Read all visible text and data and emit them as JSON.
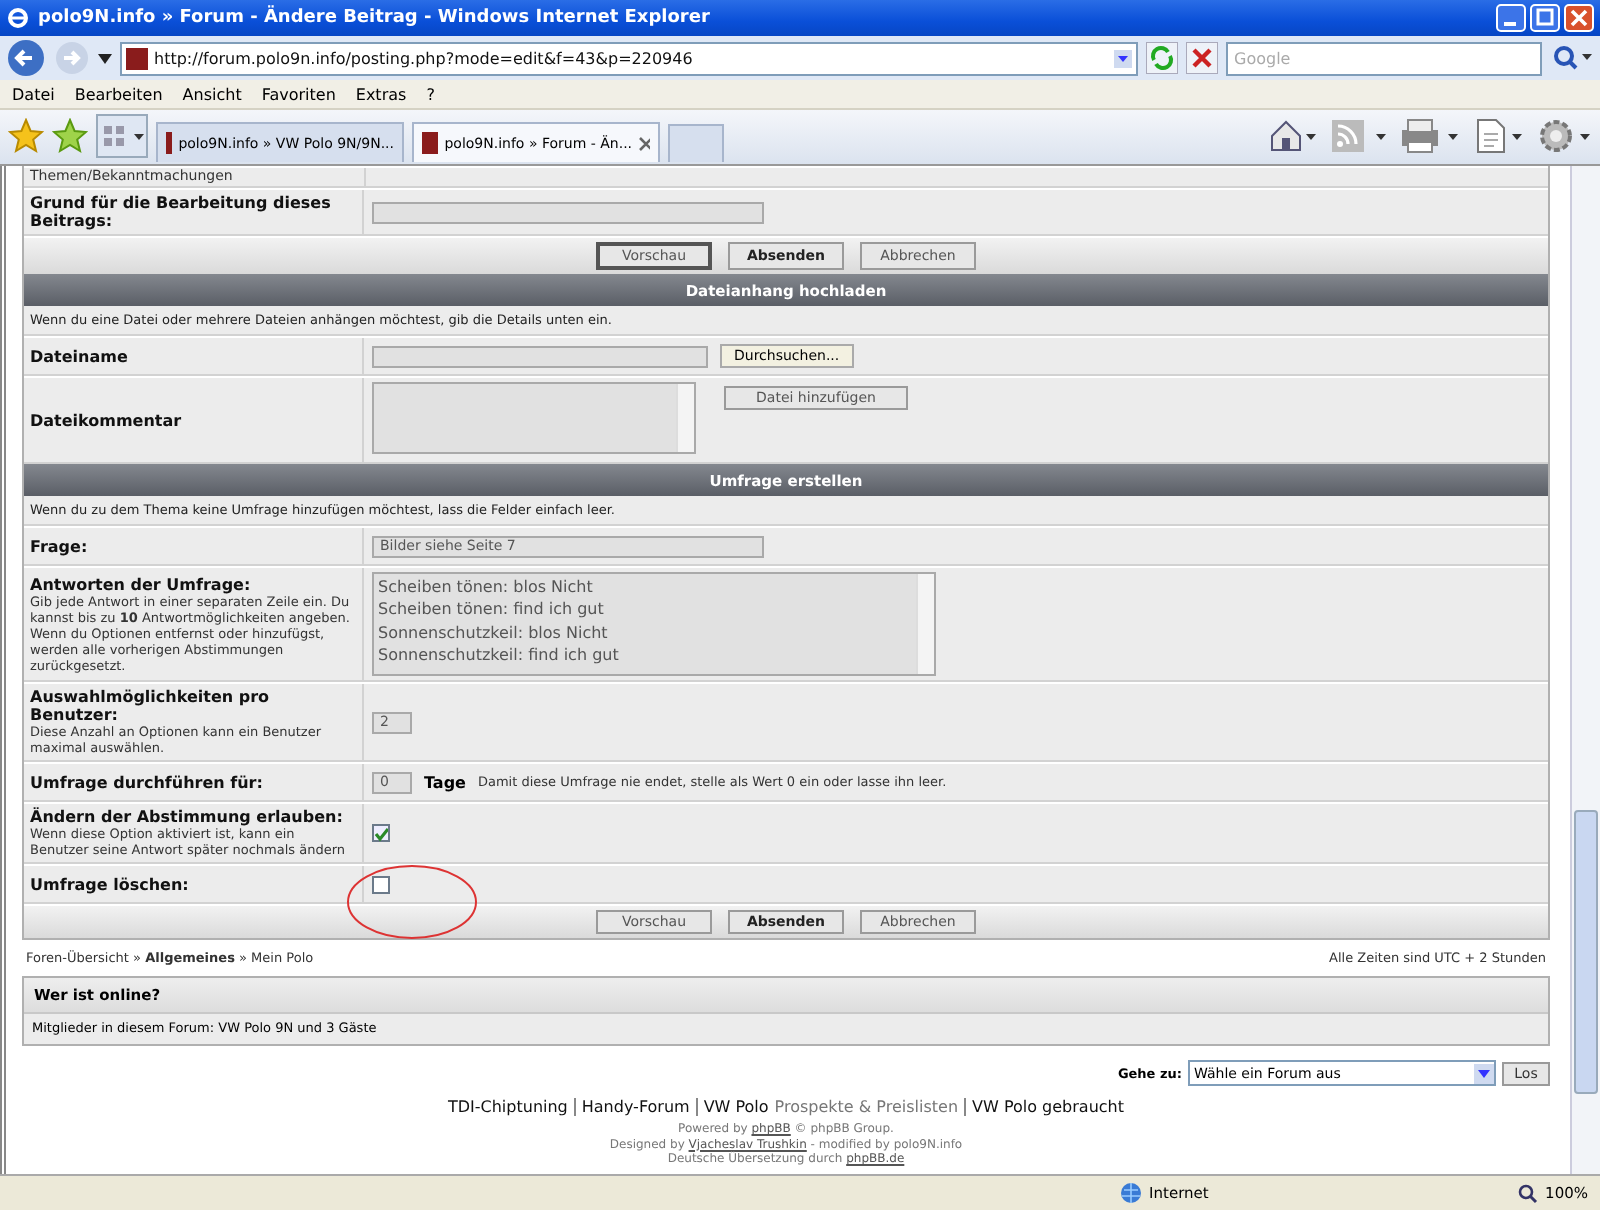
{
  "window": {
    "title": "polo9N.info » Forum - Ändere Beitrag - Windows Internet Explorer"
  },
  "address_bar": {
    "url": "http://forum.polo9n.info/posting.php?mode=edit&f=43&p=220946",
    "search_placeholder": "Google"
  },
  "menu": [
    "Datei",
    "Bearbeiten",
    "Ansicht",
    "Favoriten",
    "Extras",
    "?"
  ],
  "tabs": [
    {
      "label": "polo9N.info » VW Polo 9N/9N...",
      "selected": false
    },
    {
      "label": "polo9N.info » Forum - Än...",
      "selected": true
    }
  ],
  "form": {
    "partial_row": "Themen/Bekanntmachungen",
    "reason_label": "Grund für die Bearbeitung dieses Beitrags:",
    "buttons_top": [
      {
        "label": "Vorschau",
        "kind": "focused"
      },
      {
        "label": "Absenden",
        "kind": "primary"
      },
      {
        "label": "Abbrechen",
        "kind": "default"
      }
    ]
  },
  "attachment": {
    "title": "Dateianhang hochladen",
    "info": "Wenn du eine Datei oder mehrere Dateien anhängen möchtest, gib die Details unten ein.",
    "filename_label": "Dateiname",
    "browse_button": "Durchsuchen...",
    "comment_label": "Dateikommentar",
    "add_button": "Datei hinzufügen"
  },
  "poll": {
    "title": "Umfrage erstellen",
    "info": "Wenn du zu dem Thema keine Umfrage hinzufügen möchtest, lass die Felder einfach leer.",
    "question_label": "Frage:",
    "question_value": "Bilder siehe Seite 7",
    "answers_label": "Antworten der Umfrage:",
    "answers_help": "Gib jede Antwort in einer separaten Zeile ein. Du kannst bis zu **10** Antwortmöglichkeiten angeben. Wenn du Optionen entfernst oder hinzufügst, werden alle vorherigen Abstimmungen zurückgesetzt.",
    "answers": [
      "Scheiben tönen: blos Nicht",
      "Scheiben tönen: find ich gut",
      "Sonnenschutzkeil: blos Nicht",
      "Sonnenschutzkeil: find ich gut"
    ],
    "max_label": "Auswahlmöglichkeiten pro Benutzer:",
    "max_help": "Diese Anzahl an Optionen kann ein Benutzer maximal auswählen.",
    "max_value": "2",
    "duration_label": "Umfrage durchführen für:",
    "duration_value": "0",
    "duration_unit": "Tage",
    "duration_help": "Damit diese Umfrage nie endet, stelle als Wert 0 ein oder lasse ihn leer.",
    "change_label": "Ändern der Abstimmung erlauben:",
    "change_help": "Wenn diese Option aktiviert ist, kann ein Benutzer seine Antwort später nochmals ändern",
    "change_checked": true,
    "delete_label": "Umfrage löschen:",
    "delete_checked": false
  },
  "buttons_bottom": [
    {
      "label": "Vorschau",
      "kind": "default"
    },
    {
      "label": "Absenden",
      "kind": "primary"
    },
    {
      "label": "Abbrechen",
      "kind": "default"
    }
  ],
  "breadcrumb": "Foren-Übersicht » **Allgemeines** » Mein Polo",
  "timezone": "Alle Zeiten sind UTC + 2 Stunden",
  "online": {
    "title": "Wer ist online?",
    "text": "Mitglieder in diesem Forum: VW Polo 9N und 3 Gäste"
  },
  "jump": {
    "label": "Gehe zu:",
    "value": "Wähle ein Forum aus",
    "button": "Los"
  },
  "links": [
    {
      "text": "TDI-Chiptuning"
    },
    {
      "text": "Handy-Forum"
    },
    {
      "text": "VW Polo",
      "suffix": "Prospekte & Preislisten"
    },
    {
      "text": "VW Polo gebraucht"
    }
  ],
  "footer": [
    {
      "before": "Powered by ",
      "link": "phpBB",
      "after": " © phpBB Group."
    },
    {
      "before": "Designed by ",
      "link": "Vjacheslav Trushkin",
      "after": " - modified by polo9N.info"
    },
    {
      "before": "Deutsche Übersetzung durch ",
      "link": "phpBB.de"
    }
  ],
  "status_bar": {
    "zone": "Internet",
    "zoom": "100%"
  }
}
